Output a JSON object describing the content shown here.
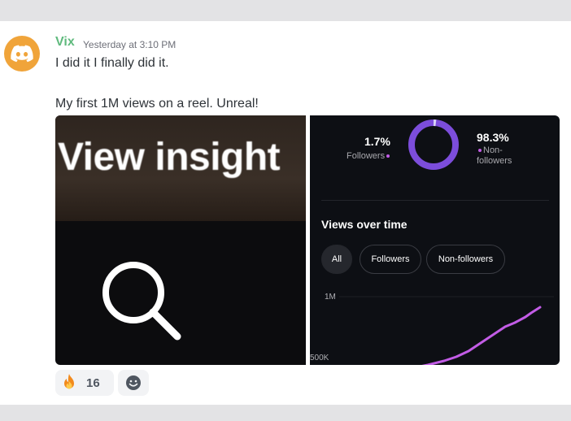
{
  "message": {
    "author": "Vix",
    "author_color": "#5fba7d",
    "timestamp": "Yesterday at 3:10 PM",
    "text_line1": "I did it I finally did it.",
    "text_line2": "My first 1M views on a reel. Unreal!",
    "avatar_icon": "discord-logo-icon",
    "avatar_color": "#f0a43a"
  },
  "attachments": {
    "left": {
      "caption": "View insight",
      "icon": "search-icon"
    },
    "right": {
      "followers_pct": "1.7%",
      "followers_label": "Followers",
      "nonfollowers_pct": "98.3%",
      "nonfollowers_label": "Non-\nfollowers",
      "views_title": "Views over time",
      "filters": [
        "All",
        "Followers",
        "Non-followers"
      ],
      "tick_1m": "1M",
      "tick_500k": "500K",
      "accent": "#c25ce6",
      "donut_color": "#7c4ddb"
    }
  },
  "reactions": [
    {
      "emoji": "fire-icon",
      "count": "16"
    }
  ],
  "add_reaction_icon": "smiley-icon"
}
